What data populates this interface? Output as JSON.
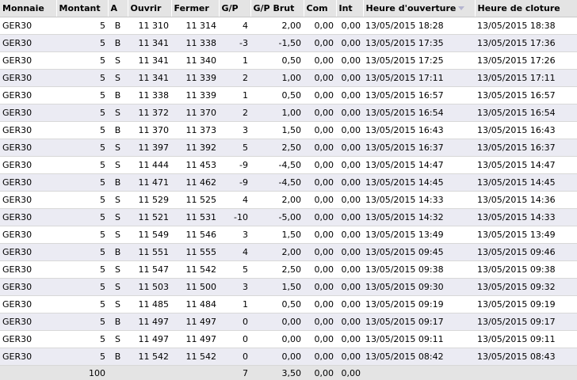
{
  "columns": [
    {
      "key": "monnaie",
      "label": "Monnaie"
    },
    {
      "key": "montant",
      "label": "Montant"
    },
    {
      "key": "a",
      "label": "A"
    },
    {
      "key": "ouvrir",
      "label": "Ouvrir"
    },
    {
      "key": "fermer",
      "label": "Fermer"
    },
    {
      "key": "gp",
      "label": "G/P"
    },
    {
      "key": "gp_brut",
      "label": "G/P Brut"
    },
    {
      "key": "com",
      "label": "Com"
    },
    {
      "key": "int",
      "label": "Int"
    },
    {
      "key": "ouverture",
      "label": "Heure d'ouverture",
      "sort": "descending"
    },
    {
      "key": "cloture",
      "label": "Heure de cloture"
    }
  ],
  "rows": [
    {
      "monnaie": "GER30",
      "montant": "5",
      "a": "B",
      "ouvrir": "11 310",
      "fermer": "11 314",
      "gp": "4",
      "gp_brut": "2,00",
      "com": "0,00",
      "int": "0,00",
      "ouverture": "13/05/2015 18:28",
      "cloture": "13/05/2015 18:38"
    },
    {
      "monnaie": "GER30",
      "montant": "5",
      "a": "B",
      "ouvrir": "11 341",
      "fermer": "11 338",
      "gp": "-3",
      "gp_brut": "-1,50",
      "com": "0,00",
      "int": "0,00",
      "ouverture": "13/05/2015 17:35",
      "cloture": "13/05/2015 17:36"
    },
    {
      "monnaie": "GER30",
      "montant": "5",
      "a": "S",
      "ouvrir": "11 341",
      "fermer": "11 340",
      "gp": "1",
      "gp_brut": "0,50",
      "com": "0,00",
      "int": "0,00",
      "ouverture": "13/05/2015 17:25",
      "cloture": "13/05/2015 17:26"
    },
    {
      "monnaie": "GER30",
      "montant": "5",
      "a": "S",
      "ouvrir": "11 341",
      "fermer": "11 339",
      "gp": "2",
      "gp_brut": "1,00",
      "com": "0,00",
      "int": "0,00",
      "ouverture": "13/05/2015 17:11",
      "cloture": "13/05/2015 17:11"
    },
    {
      "monnaie": "GER30",
      "montant": "5",
      "a": "B",
      "ouvrir": "11 338",
      "fermer": "11 339",
      "gp": "1",
      "gp_brut": "0,50",
      "com": "0,00",
      "int": "0,00",
      "ouverture": "13/05/2015 16:57",
      "cloture": "13/05/2015 16:57"
    },
    {
      "monnaie": "GER30",
      "montant": "5",
      "a": "S",
      "ouvrir": "11 372",
      "fermer": "11 370",
      "gp": "2",
      "gp_brut": "1,00",
      "com": "0,00",
      "int": "0,00",
      "ouverture": "13/05/2015 16:54",
      "cloture": "13/05/2015 16:54"
    },
    {
      "monnaie": "GER30",
      "montant": "5",
      "a": "B",
      "ouvrir": "11 370",
      "fermer": "11 373",
      "gp": "3",
      "gp_brut": "1,50",
      "com": "0,00",
      "int": "0,00",
      "ouverture": "13/05/2015 16:43",
      "cloture": "13/05/2015 16:43"
    },
    {
      "monnaie": "GER30",
      "montant": "5",
      "a": "S",
      "ouvrir": "11 397",
      "fermer": "11 392",
      "gp": "5",
      "gp_brut": "2,50",
      "com": "0,00",
      "int": "0,00",
      "ouverture": "13/05/2015 16:37",
      "cloture": "13/05/2015 16:37"
    },
    {
      "monnaie": "GER30",
      "montant": "5",
      "a": "S",
      "ouvrir": "11 444",
      "fermer": "11 453",
      "gp": "-9",
      "gp_brut": "-4,50",
      "com": "0,00",
      "int": "0,00",
      "ouverture": "13/05/2015 14:47",
      "cloture": "13/05/2015 14:47"
    },
    {
      "monnaie": "GER30",
      "montant": "5",
      "a": "B",
      "ouvrir": "11 471",
      "fermer": "11 462",
      "gp": "-9",
      "gp_brut": "-4,50",
      "com": "0,00",
      "int": "0,00",
      "ouverture": "13/05/2015 14:45",
      "cloture": "13/05/2015 14:45"
    },
    {
      "monnaie": "GER30",
      "montant": "5",
      "a": "S",
      "ouvrir": "11 529",
      "fermer": "11 525",
      "gp": "4",
      "gp_brut": "2,00",
      "com": "0,00",
      "int": "0,00",
      "ouverture": "13/05/2015 14:33",
      "cloture": "13/05/2015 14:36"
    },
    {
      "monnaie": "GER30",
      "montant": "5",
      "a": "S",
      "ouvrir": "11 521",
      "fermer": "11 531",
      "gp": "-10",
      "gp_brut": "-5,00",
      "com": "0,00",
      "int": "0,00",
      "ouverture": "13/05/2015 14:32",
      "cloture": "13/05/2015 14:33"
    },
    {
      "monnaie": "GER30",
      "montant": "5",
      "a": "S",
      "ouvrir": "11 549",
      "fermer": "11 546",
      "gp": "3",
      "gp_brut": "1,50",
      "com": "0,00",
      "int": "0,00",
      "ouverture": "13/05/2015 13:49",
      "cloture": "13/05/2015 13:49"
    },
    {
      "monnaie": "GER30",
      "montant": "5",
      "a": "B",
      "ouvrir": "11 551",
      "fermer": "11 555",
      "gp": "4",
      "gp_brut": "2,00",
      "com": "0,00",
      "int": "0,00",
      "ouverture": "13/05/2015 09:45",
      "cloture": "13/05/2015 09:46"
    },
    {
      "monnaie": "GER30",
      "montant": "5",
      "a": "S",
      "ouvrir": "11 547",
      "fermer": "11 542",
      "gp": "5",
      "gp_brut": "2,50",
      "com": "0,00",
      "int": "0,00",
      "ouverture": "13/05/2015 09:38",
      "cloture": "13/05/2015 09:38"
    },
    {
      "monnaie": "GER30",
      "montant": "5",
      "a": "S",
      "ouvrir": "11 503",
      "fermer": "11 500",
      "gp": "3",
      "gp_brut": "1,50",
      "com": "0,00",
      "int": "0,00",
      "ouverture": "13/05/2015 09:30",
      "cloture": "13/05/2015 09:32"
    },
    {
      "monnaie": "GER30",
      "montant": "5",
      "a": "S",
      "ouvrir": "11 485",
      "fermer": "11 484",
      "gp": "1",
      "gp_brut": "0,50",
      "com": "0,00",
      "int": "0,00",
      "ouverture": "13/05/2015 09:19",
      "cloture": "13/05/2015 09:19"
    },
    {
      "monnaie": "GER30",
      "montant": "5",
      "a": "B",
      "ouvrir": "11 497",
      "fermer": "11 497",
      "gp": "0",
      "gp_brut": "0,00",
      "com": "0,00",
      "int": "0,00",
      "ouverture": "13/05/2015 09:17",
      "cloture": "13/05/2015 09:17"
    },
    {
      "monnaie": "GER30",
      "montant": "5",
      "a": "S",
      "ouvrir": "11 497",
      "fermer": "11 497",
      "gp": "0",
      "gp_brut": "0,00",
      "com": "0,00",
      "int": "0,00",
      "ouverture": "13/05/2015 09:11",
      "cloture": "13/05/2015 09:11"
    },
    {
      "monnaie": "GER30",
      "montant": "5",
      "a": "B",
      "ouvrir": "11 542",
      "fermer": "11 542",
      "gp": "0",
      "gp_brut": "0,00",
      "com": "0,00",
      "int": "0,00",
      "ouverture": "13/05/2015 08:42",
      "cloture": "13/05/2015 08:43"
    }
  ],
  "totals": {
    "monnaie": "",
    "montant": "100",
    "a": "",
    "ouvrir": "",
    "fermer": "",
    "gp": "7",
    "gp_brut": "3,50",
    "com": "0,00",
    "int": "0,00",
    "ouverture": "",
    "cloture": ""
  },
  "icons": {
    "sort": "sort-descending-icon"
  },
  "colors": {
    "header_bg": "#e4e4e4",
    "row_alt_bg": "#ebebf3",
    "sort_arrow": "#b5b5d0"
  }
}
